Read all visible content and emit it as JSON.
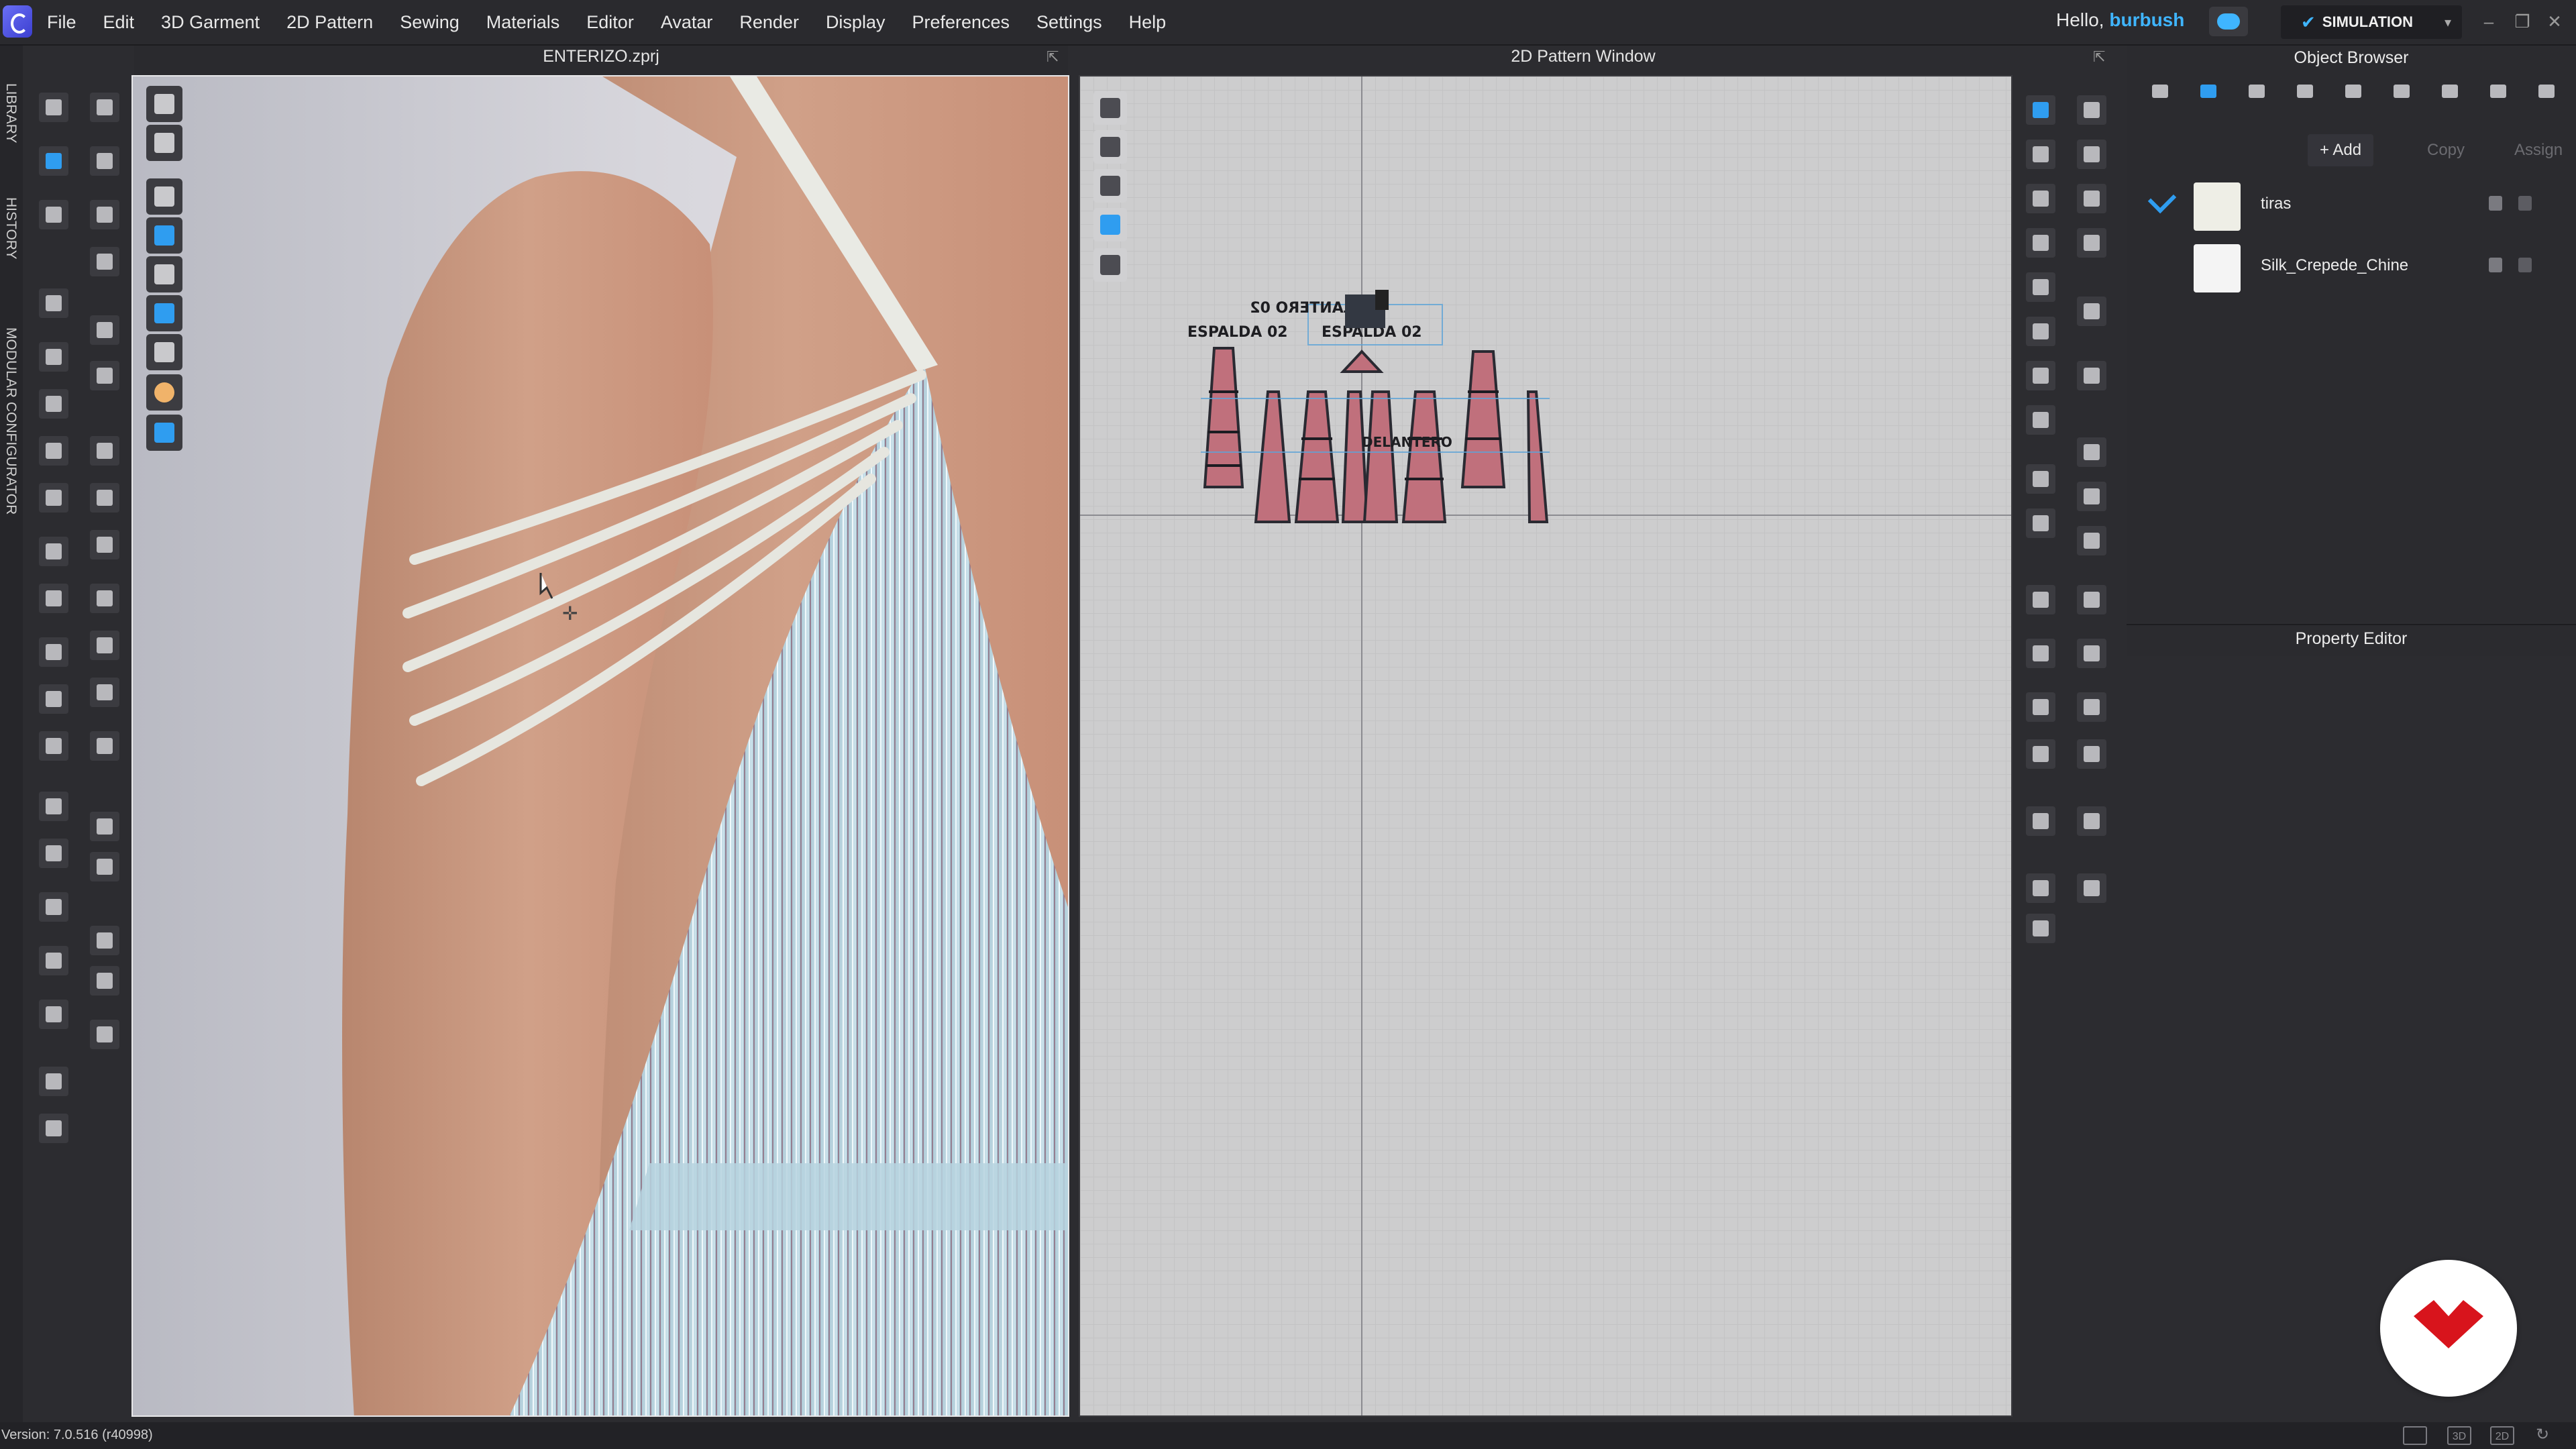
{
  "menu": {
    "items": [
      "File",
      "Edit",
      "3D Garment",
      "2D Pattern",
      "Sewing",
      "Materials",
      "Editor",
      "Avatar",
      "Render",
      "Display",
      "Preferences",
      "Settings",
      "Help"
    ],
    "greeting_prefix": "Hello, ",
    "username": "burbush",
    "mode_label": "SIMULATION"
  },
  "side_tabs": [
    "LIBRARY",
    "HISTORY",
    "MODULAR CONFIGURATOR"
  ],
  "viewport3d": {
    "title": "ENTERIZO.zprj"
  },
  "pattern_window": {
    "title": "2D Pattern Window",
    "piece_labels": [
      "ESPALDA 02",
      "ESPALDA 02",
      "DELANTERO 02",
      "DELANTERO"
    ]
  },
  "object_browser": {
    "title": "Object Browser",
    "actions": {
      "add": "+ Add",
      "copy": "Copy",
      "assign": "Assign"
    },
    "materials": [
      {
        "name": "tiras",
        "checked": true,
        "swatch": "#eeeee6"
      },
      {
        "name": "Silk_Crepede_Chine",
        "checked": false,
        "swatch": "#f4f4f4"
      }
    ]
  },
  "property_editor": {
    "title": "Property Editor"
  },
  "status": {
    "version": "Version: 7.0.516 (r40998)",
    "view_modes": [
      "",
      "3D",
      "2D"
    ]
  },
  "colors": {
    "accent": "#2f9df0",
    "username": "#3fb5ff",
    "pattern_fill": "#c0707c",
    "brand_red": "#d8141c"
  }
}
